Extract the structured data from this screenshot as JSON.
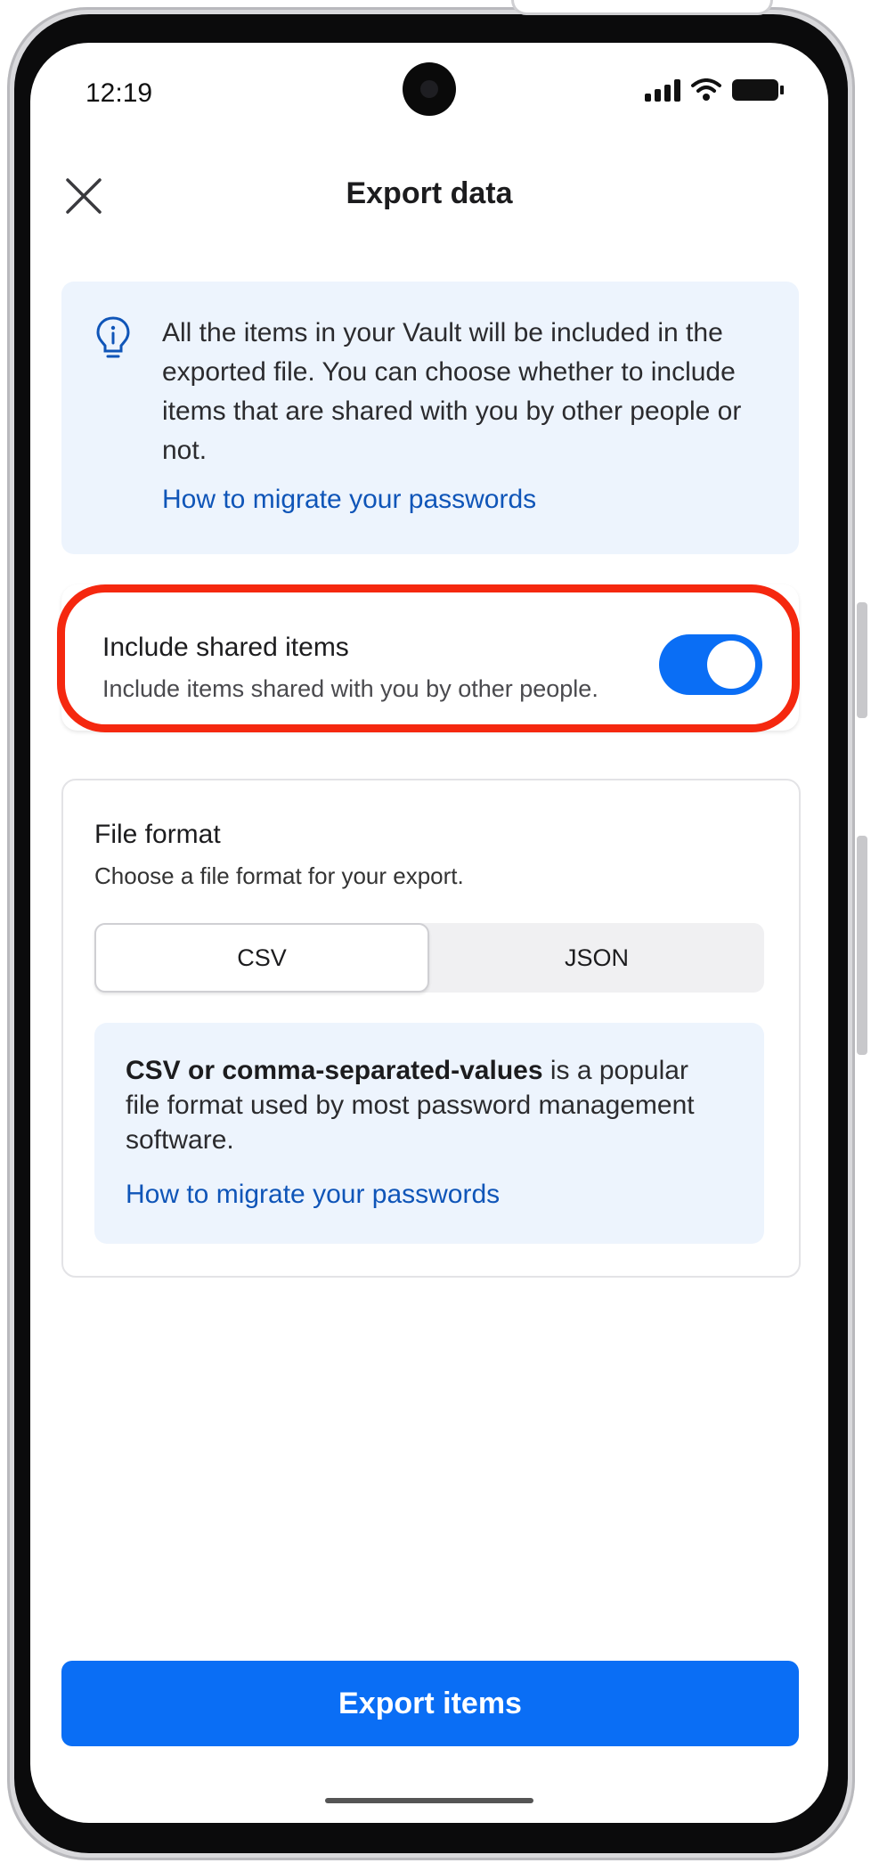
{
  "status_bar": {
    "time": "12:19"
  },
  "header": {
    "title": "Export data"
  },
  "info": {
    "text": "All the items in your Vault will be included in the exported file. You can choose whether to include items that are shared with you by other people or not.",
    "link": "How to migrate your passwords"
  },
  "shared_items": {
    "title": "Include shared items",
    "subtitle": "Include items shared with you by other people.",
    "enabled": true
  },
  "file_format": {
    "title": "File format",
    "subtitle": "Choose a file format for your export.",
    "options": [
      "CSV",
      "JSON"
    ],
    "selected": "CSV",
    "description_bold": "CSV or comma-separated-values",
    "description_rest": " is a popular file format used by most password management software.",
    "link": "How to migrate your passwords"
  },
  "export_button": {
    "label": "Export items"
  },
  "colors": {
    "accent": "#0a6ef5",
    "link": "#0f55b8",
    "highlight": "#f5280f",
    "info_bg": "#edf4fd"
  }
}
